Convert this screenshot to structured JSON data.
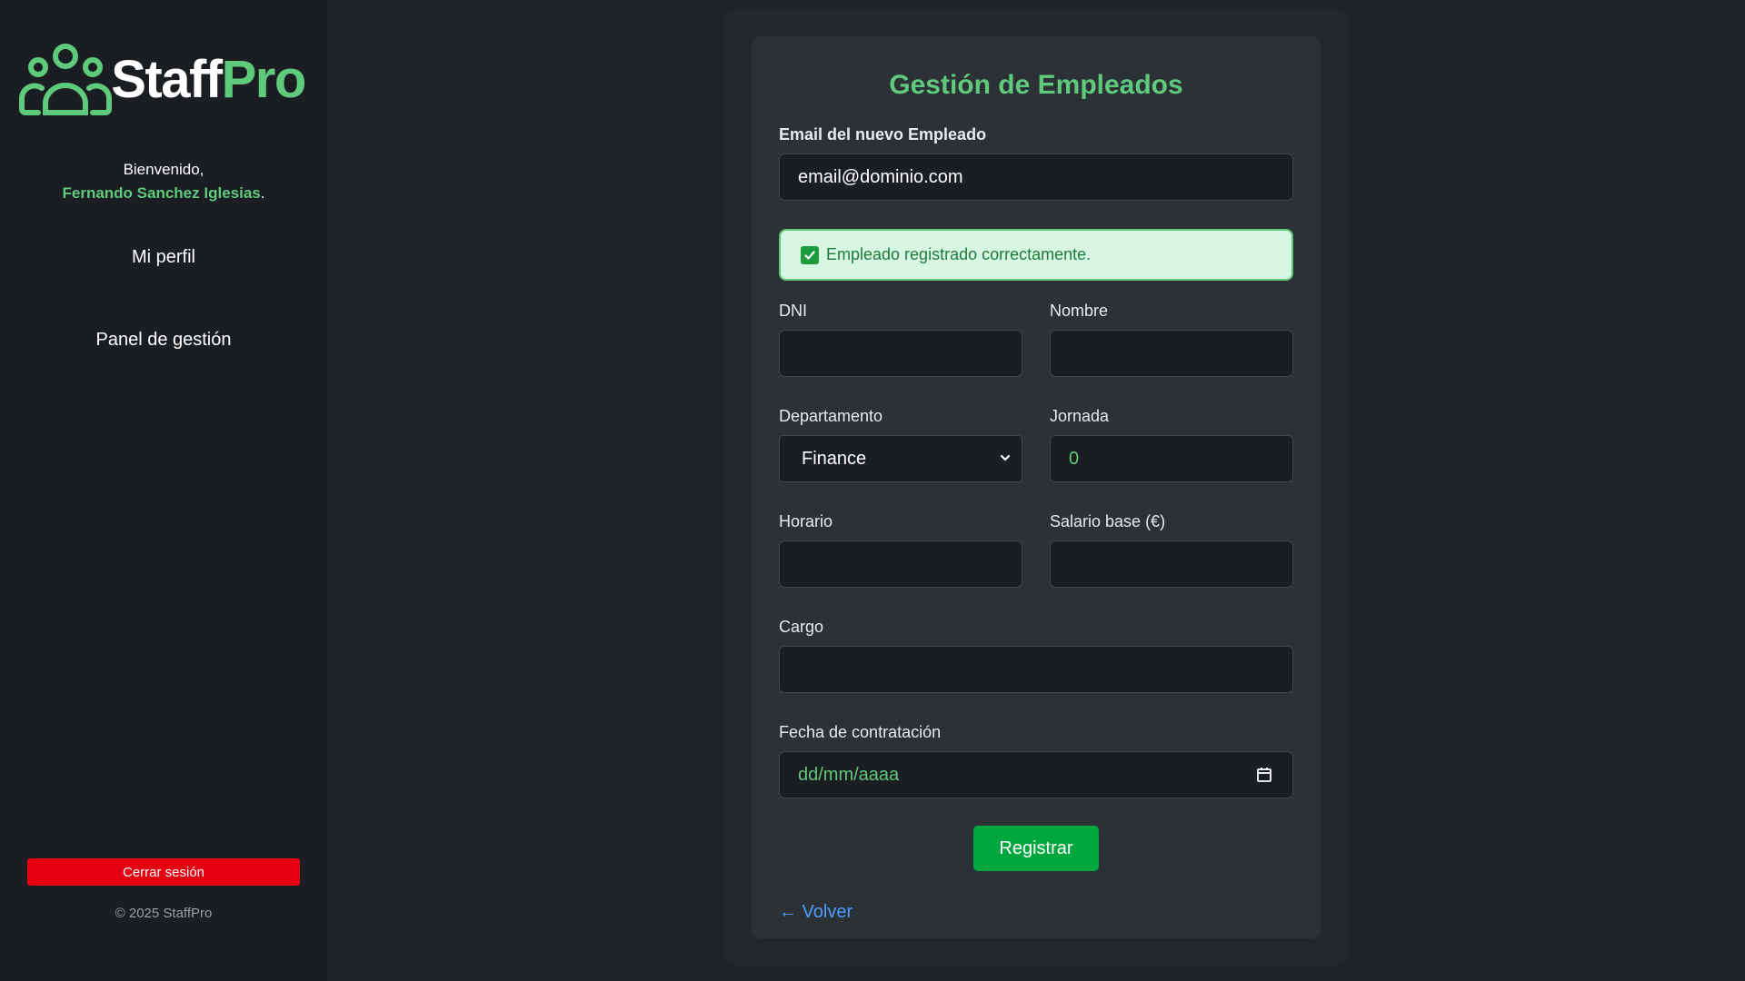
{
  "sidebar": {
    "logo": {
      "part1": "Staff",
      "part2": "Pro",
      "icon": "users-group-icon"
    },
    "welcome_text": "Bienvenido,",
    "user_name": "Fernando Sanchez Iglesias",
    "name_suffix": ".",
    "nav": [
      {
        "label": "Mi perfil"
      },
      {
        "label": "Panel de gestión"
      }
    ],
    "logout_label": "Cerrar sesión",
    "copyright": "© 2025 StaffPro"
  },
  "form": {
    "title": "Gestión de Empleados",
    "email": {
      "label": "Email del nuevo Empleado",
      "value": "email@dominio.com"
    },
    "alert": {
      "text": "Empleado registrado correctamente.",
      "icon": "check-icon"
    },
    "dni": {
      "label": "DNI",
      "value": ""
    },
    "nombre": {
      "label": "Nombre",
      "value": ""
    },
    "departamento": {
      "label": "Departamento",
      "selected": "Finance"
    },
    "jornada": {
      "label": "Jornada",
      "value": "0"
    },
    "horario": {
      "label": "Horario",
      "value": ""
    },
    "salario": {
      "label": "Salario base (€)",
      "value": ""
    },
    "cargo": {
      "label": "Cargo",
      "value": ""
    },
    "fecha": {
      "label": "Fecha de contratación",
      "placeholder": "dd/mm/aaaa"
    },
    "submit_label": "Registrar",
    "back_label": "← Volver"
  },
  "colors": {
    "accent": "#5fc97c",
    "submit": "#00a63e",
    "logout": "#e60012",
    "link": "#4a9eff",
    "alert_bg": "#d8f7e2"
  }
}
